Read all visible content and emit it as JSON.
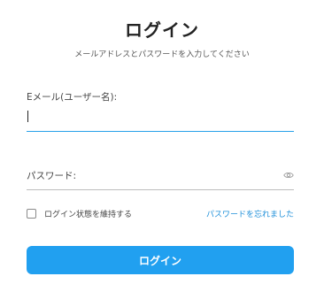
{
  "header": {
    "title": "ログイン",
    "subtitle": "メールアドレスとパスワードを入力してください"
  },
  "form": {
    "email": {
      "label": "Eメール(ユーザー名):",
      "value": ""
    },
    "password": {
      "label": "パスワード:",
      "value": "",
      "toggle_icon": "eye-icon"
    },
    "remember_me": {
      "label": "ログイン状態を維持する",
      "checked": false
    },
    "forgot_password_link": "パスワードを忘れました",
    "submit_label": "ログイン"
  },
  "colors": {
    "accent": "#21a0f0",
    "link": "#1e8fd9",
    "active_underline": "#28a1ea"
  }
}
